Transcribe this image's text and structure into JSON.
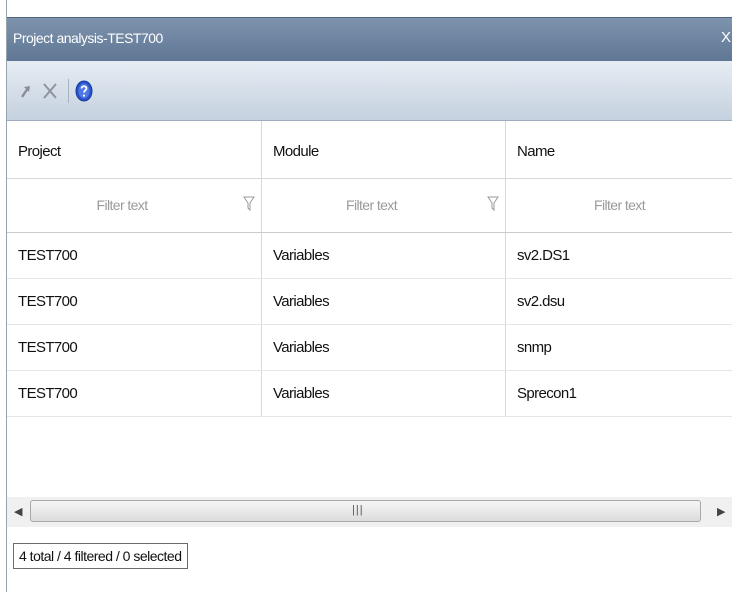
{
  "window": {
    "title": "Project analysis-TEST700",
    "close_label": "X"
  },
  "toolbar": {
    "buttons": [
      {
        "icon": "arrow-up-right-icon",
        "enabled": false
      },
      {
        "icon": "delete-x-icon",
        "enabled": false
      },
      {
        "icon": "help-icon",
        "enabled": true
      }
    ]
  },
  "grid": {
    "columns": [
      "Project",
      "Module",
      "Name"
    ],
    "filter_placeholder": "Filter text",
    "rows": [
      {
        "project": "TEST700",
        "module": "Variables",
        "name": "sv2.DS1"
      },
      {
        "project": "TEST700",
        "module": "Variables",
        "name": "sv2.dsu"
      },
      {
        "project": "TEST700",
        "module": "Variables",
        "name": "snmp"
      },
      {
        "project": "TEST700",
        "module": "Variables",
        "name": "Sprecon1"
      }
    ]
  },
  "status": {
    "summary": "4 total / 4 filtered / 0 selected"
  },
  "colors": {
    "titlebar": "#6f86a3",
    "toolbar": "#d5dee9",
    "help_icon": "#2a52c9"
  }
}
